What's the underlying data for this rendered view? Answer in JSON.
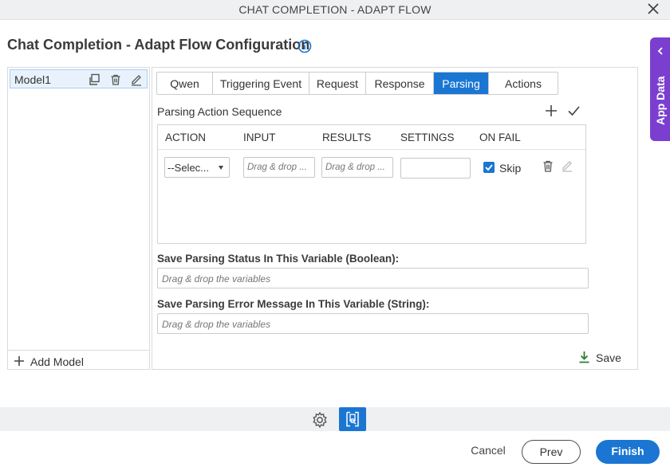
{
  "window": {
    "title": "CHAT COMPLETION - ADAPT FLOW"
  },
  "page": {
    "title": "Chat Completion - Adapt Flow Configuration"
  },
  "app_data": {
    "label": "App Data"
  },
  "models": {
    "items": [
      {
        "name": "Model1"
      }
    ],
    "add_label": "Add Model"
  },
  "tabs": [
    {
      "label": "Qwen",
      "active": false
    },
    {
      "label": "Triggering Event",
      "active": false
    },
    {
      "label": "Request",
      "active": false
    },
    {
      "label": "Response",
      "active": false
    },
    {
      "label": "Parsing",
      "active": true
    },
    {
      "label": "Actions",
      "active": false
    }
  ],
  "parsing": {
    "sequence_title": "Parsing Action Sequence",
    "columns": [
      "ACTION",
      "INPUT",
      "RESULTS",
      "SETTINGS",
      "ON FAIL"
    ],
    "rows": [
      {
        "action": "--Selec...",
        "input_placeholder": "Drag & drop ...",
        "results_placeholder": "Drag & drop ...",
        "settings": "",
        "on_fail_checked": true,
        "on_fail_label": "Skip"
      }
    ],
    "status_var_label": "Save Parsing Status In This Variable (Boolean):",
    "status_var_placeholder": "Drag & drop the variables",
    "error_var_label": "Save Parsing Error Message In This Variable (String):",
    "error_var_placeholder": "Drag & drop the variables",
    "save_label": "Save"
  },
  "footer": {
    "cancel": "Cancel",
    "prev": "Prev",
    "finish": "Finish"
  },
  "colors": {
    "primary": "#1a76d2",
    "app_data": "#7b3fd0",
    "save_icon": "#2e7d32"
  }
}
